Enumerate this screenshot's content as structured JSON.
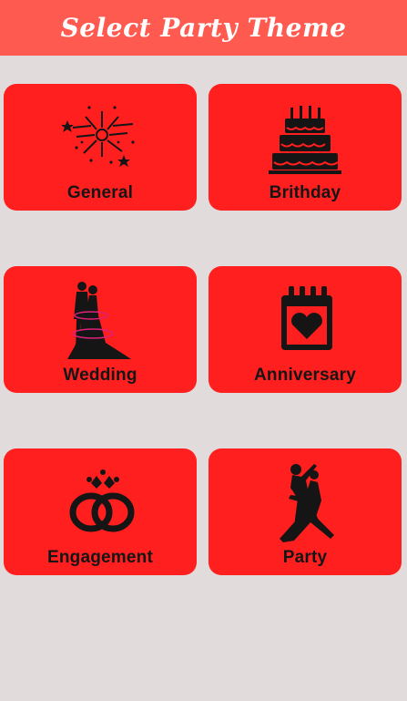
{
  "header": {
    "title": "Select Party Theme"
  },
  "colors": {
    "header_bg": "#ff5a4f",
    "tile_bg": "#ff1f1f",
    "page_bg": "#e2dbdb",
    "icon": "#151515"
  },
  "themes": [
    {
      "label": "General",
      "icon": "fireworks-icon"
    },
    {
      "label": "Brithday",
      "icon": "birthday-cake-icon"
    },
    {
      "label": "Wedding",
      "icon": "wedding-couple-icon"
    },
    {
      "label": "Anniversary",
      "icon": "heart-calendar-icon"
    },
    {
      "label": "Engagement",
      "icon": "engagement-rings-icon"
    },
    {
      "label": "Party",
      "icon": "dancing-couple-icon"
    }
  ]
}
